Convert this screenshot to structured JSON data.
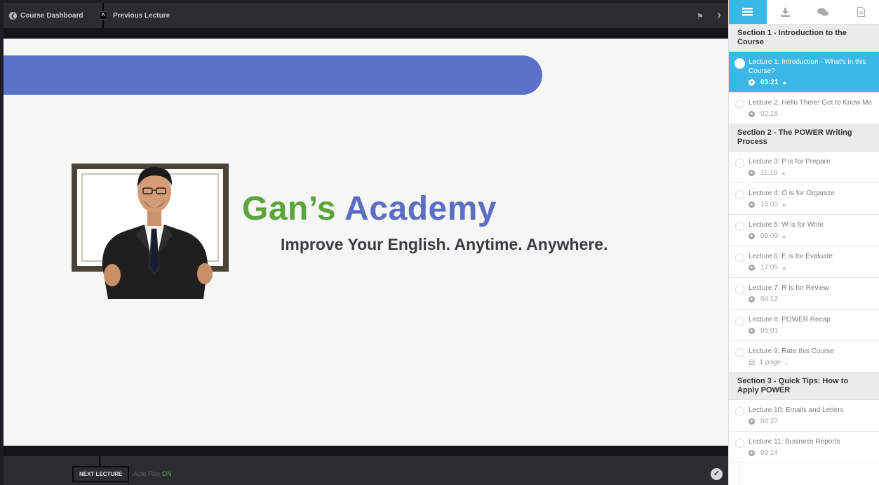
{
  "topbar": {
    "dashboard_label": "Course Dashboard",
    "previous_label": "Previous Lecture"
  },
  "slide": {
    "brand_part1": "Gan’s",
    "brand_part2": "Academy",
    "tagline": "Improve Your English. Anytime. Anywhere."
  },
  "bottombar": {
    "next_label": "NEXT LECTURE",
    "autoplay_label": "Auto Play",
    "autoplay_state": "ON"
  },
  "sidebar": {
    "tabs": [
      "curriculum-icon",
      "download-icon",
      "discussion-icon",
      "notes-icon"
    ],
    "sections": [
      {
        "title": "Section 1 - Introduction to the Course",
        "lectures": [
          {
            "title": "Lecture 1: Introduction - What's in this Course?",
            "meta": "03:21",
            "active": true
          },
          {
            "title": "Lecture 2: Hello There! Get to Know Me",
            "meta": "02:15"
          }
        ]
      },
      {
        "title": "Section 2 - The POWER Writing Process",
        "lectures": [
          {
            "title": "Lecture 3: P is for Prepare",
            "meta": "11:19"
          },
          {
            "title": "Lecture 4: O is for Organize",
            "meta": "15:00"
          },
          {
            "title": "Lecture 5: W is for Write",
            "meta": "09:09"
          },
          {
            "title": "Lecture 6: E is for Evaluate",
            "meta": "17:05"
          },
          {
            "title": "Lecture 7: R is for Review",
            "meta": "04:12"
          },
          {
            "title": "Lecture 8: POWER Recap",
            "meta": "05:01"
          },
          {
            "title": "Lecture 9: Rate this Course",
            "meta": "1 page"
          }
        ]
      },
      {
        "title": "Section 3 - Quick Tips: How to Apply POWER",
        "lectures": [
          {
            "title": "Lecture 10: Emails and Letters",
            "meta": "04:27"
          },
          {
            "title": "Lecture 11: Business Reports",
            "meta": "03:14"
          }
        ]
      }
    ]
  },
  "colors": {
    "accent": "#3ab7e6",
    "brand_green": "#5ba53a",
    "brand_blue": "#5a6fc4"
  }
}
